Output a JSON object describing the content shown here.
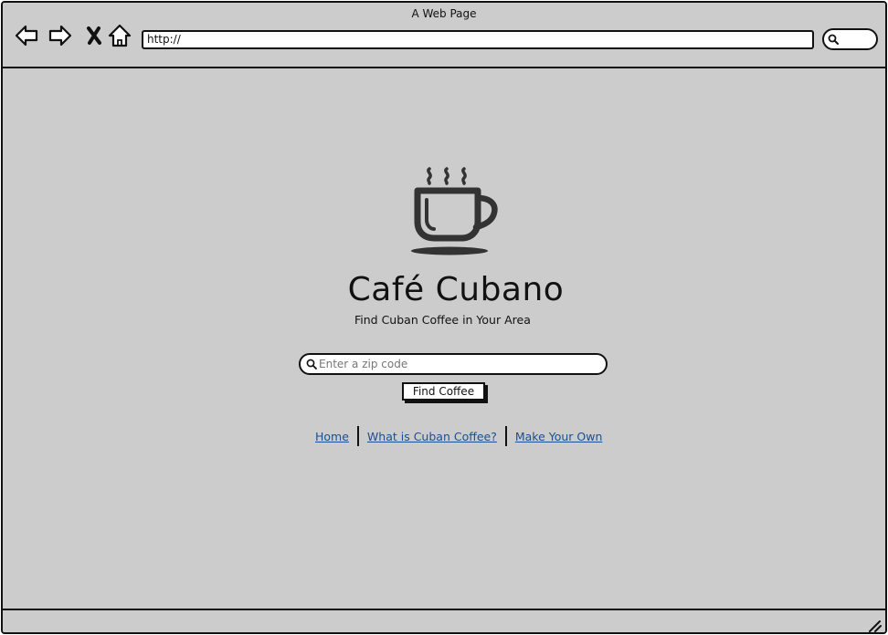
{
  "window": {
    "title": "A Web Page"
  },
  "toolbar": {
    "back_icon": "back-arrow-icon",
    "forward_icon": "forward-arrow-icon",
    "stop_icon": "close-icon",
    "home_icon": "home-icon",
    "url": "http://",
    "search_icon": "search-icon"
  },
  "hero": {
    "logo_icon": "coffee-cup-icon",
    "title": "Café Cubano",
    "tagline": "Find Cuban Coffee in Your Area"
  },
  "search": {
    "placeholder": "Enter a zip code",
    "value": "",
    "button_label": "Find Coffee"
  },
  "links": [
    {
      "label": "Home"
    },
    {
      "label": "What is Cuban Coffee?"
    },
    {
      "label": "Make Your Own"
    }
  ],
  "colors": {
    "background": "#cccccc",
    "link": "#1b4f8f",
    "outline": "#111111"
  }
}
